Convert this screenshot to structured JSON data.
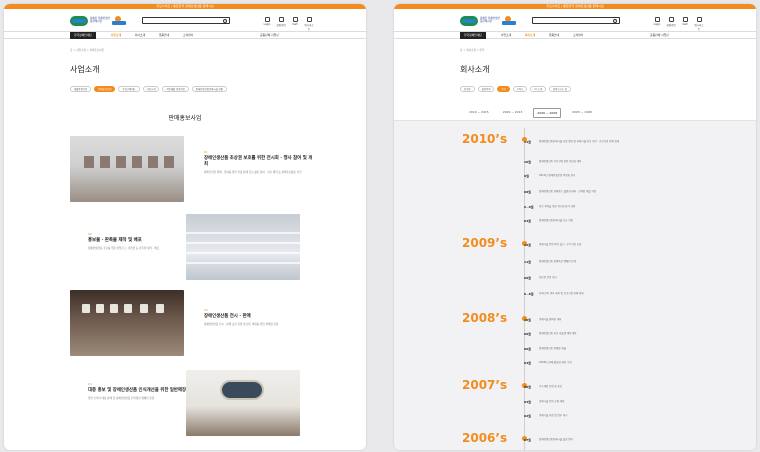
{
  "topbar_text": "주요사이트 | 통합한국 장애인생산품 판매시설",
  "header": {
    "org_text": "장애인 장애인생산품판매시설",
    "utils": [
      "Login",
      "회원가입",
      "Cart",
      "위시리스트"
    ]
  },
  "nav": {
    "home": "한국장애인재단",
    "items": [
      "사업소개",
      "회사소개",
      "물품안내",
      "고객센터"
    ],
    "right": "공동판매 사업단"
  },
  "left": {
    "breadcrumb": "홈 > 사업소개 > 판매홍보사업",
    "page_title": "사업소개",
    "tabs": [
      "재활용품사업",
      "판매홍보사업",
      "우선구매제도",
      "기관소개",
      "직업재활 연계사업",
      "장애인생산품판매시설 현황"
    ],
    "active_tab": 1,
    "section_title": "판매홍보사업",
    "items": [
      {
        "num": "01",
        "head": "장애인생산품 초상권 보호를 위한 전시회 · 행사 참여 및 개최",
        "desc": "판매촉진을 위해 · 행사를 위한 전광 판매 홍보 활동 참여 · 자료 제작 등 판매홍보활동 추진"
      },
      {
        "num": "02",
        "head": "홍보물 · 판촉물 제작 및 배포",
        "desc": "장애인생산품 홍보를 위한 카탈로그, 리플렛 등 판촉물 제작 · 배포"
      },
      {
        "num": "03",
        "head": "장애인생산품 전시 · 판매",
        "desc": "장애인생산품 전시 · 판매 공간 운영 및 판로 확대를 위한 판매장 운영"
      },
      {
        "num": "04",
        "head": "대중 홍보 및 장애인생산품 인식개선을 위한 일반매장 운영",
        "desc": "일반 소비자 대상 판매 및 장애인생산품 인식개선 캠페인 운영"
      }
    ]
  },
  "right": {
    "breadcrumb": "홈 > 회사소개 > 연혁",
    "page_title": "회사소개",
    "tabs": [
      "인사말",
      "설립목적",
      "연혁",
      "조직도",
      "CI 소개",
      "찾아오시는 길"
    ],
    "active_tab": 2,
    "year_tabs": [
      "2010 ~ 2015",
      "2009 ~ 2013",
      "2006 ~ 2008",
      "2005 ~ 1998"
    ],
    "active_year": 2,
    "timeline": [
      {
        "year": "2010’s",
        "entries": [
          {
            "month": "11월",
            "text": "장애인생산품판매시설 지정 확대 및 판매시설 홍보 추진 · 공공기관 판매 확대"
          },
          {
            "month": "10월",
            "text": "장애인생산품 우선구매 관련 간담회 개최"
          },
          {
            "month": "9월",
            "text": "2010년 장애인생산품 박람회 참가"
          },
          {
            "month": "08월",
            "text": "장애인생산품 판매홍보 설명회 개최 · 신제품 개발 지원"
          },
          {
            "month": "6~8월",
            "text": "판로 개척을 위한 전시회 참가 지원"
          },
          {
            "month": "03월",
            "text": "장애인생산품판매시설 신규 지정"
          }
        ]
      },
      {
        "year": "2009’s",
        "entries": [
          {
            "month": "12월",
            "text": "판매시설 운영 평가 실시 · 우수기관 포상"
          },
          {
            "month": "11월",
            "text": "장애인생산품 판매촉진 캠페인 전개"
          },
          {
            "month": "09월",
            "text": "홍보관 운영 개시"
          },
          {
            "month": "6~8월",
            "text": "하계 판촉 행사 개최 및 공공기관 판매 확대"
          }
        ]
      },
      {
        "year": "2008’s",
        "entries": [
          {
            "month": "10월",
            "text": "판매시설 협의회 개최"
          },
          {
            "month": "09월",
            "text": "장애인생산품 홍보 리플렛 제작 배포"
          },
          {
            "month": "06월",
            "text": "장애인생산품 판매장 개설"
          },
          {
            "month": "04월",
            "text": "2008년 판매 활성화 계획 수립"
          }
        ]
      },
      {
        "year": "2007’s",
        "entries": [
          {
            "month": "09월",
            "text": "우수제품 선정 및 홍보"
          },
          {
            "month": "03월",
            "text": "판매시설 운영 규정 제정"
          },
          {
            "month": "02월",
            "text": "판매시설 지정 및 업무 개시"
          }
        ]
      },
      {
        "year": "2006’s",
        "entries": [
          {
            "month": "07월",
            "text": "장애인생산품판매시설 설립 준비"
          }
        ]
      }
    ]
  }
}
